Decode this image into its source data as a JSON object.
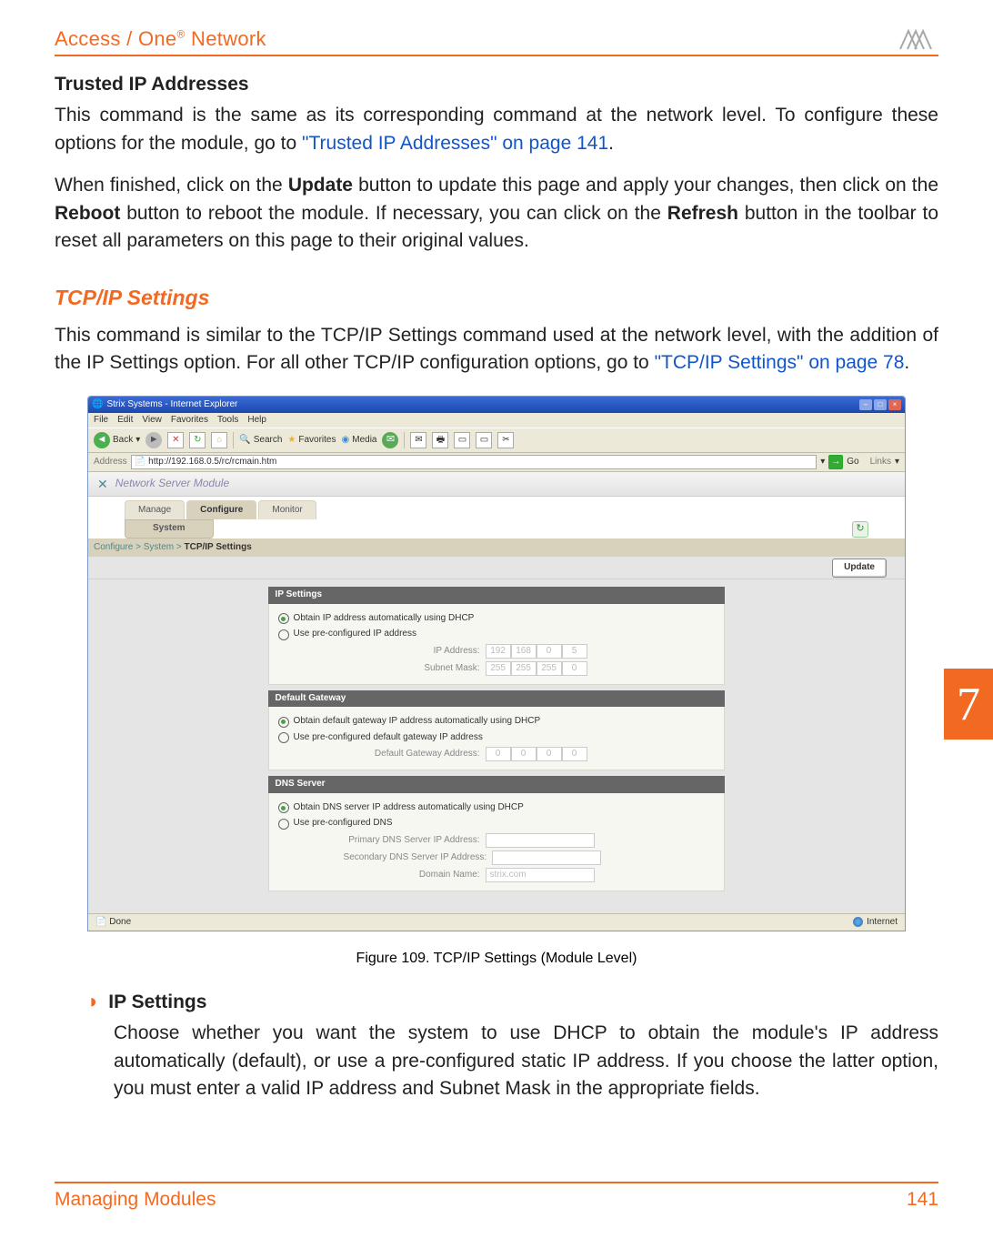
{
  "header": {
    "product_line": "Access / One",
    "reg": "®",
    "product_suffix": " Network"
  },
  "section1": {
    "title": "Trusted IP Addresses",
    "para1a": "This command is the same as its corresponding command at the network level. To configure these options for the module, go to ",
    "link1": "\"Trusted IP Addresses\" on page 141",
    "para1b": ".",
    "para2a": "When finished, click on the ",
    "b1": "Update",
    "para2b": " button to update this page and apply your changes, then click on the ",
    "b2": "Reboot",
    "para2c": " button to reboot the module. If necessary, you can click on the ",
    "b3": "Refresh",
    "para2d": " button in the toolbar to reset all parameters on this page to their original values."
  },
  "section2": {
    "title": "TCP/IP Settings",
    "para1a": "This command is similar to the TCP/IP Settings command used at the network level, with the addition of the IP Settings option. For all other TCP/IP configuration options, go to ",
    "link1": "\"TCP/IP Settings\" on page 78",
    "para1b": "."
  },
  "figure": {
    "caption": "Figure 109. TCP/IP Settings (Module Level)",
    "ie": {
      "title": "Strix Systems - Internet Explorer",
      "menu": {
        "file": "File",
        "edit": "Edit",
        "view": "View",
        "favorites": "Favorites",
        "tools": "Tools",
        "help": "Help"
      },
      "toolbar": {
        "back": "Back",
        "search": "Search",
        "favorites": "Favorites",
        "media": "Media"
      },
      "address_label": "Address",
      "address_value": "http://192.168.0.5/rc/rcmain.htm",
      "go": "Go",
      "links": "Links",
      "module_bar": "Network Server Module",
      "tabs": {
        "manage": "Manage",
        "configure": "Configure",
        "monitor": "Monitor"
      },
      "subtab": "System",
      "breadcrumb_prefix": "Configure > System > ",
      "breadcrumb_current": "TCP/IP Settings",
      "update_btn": "Update",
      "panels": {
        "ip": {
          "title": "IP Settings",
          "opt1": "Obtain IP address automatically using DHCP",
          "opt2": "Use pre-configured IP address",
          "ip_label": "IP Address:",
          "ip_octets": [
            "192",
            "168",
            "0",
            "5"
          ],
          "mask_label": "Subnet Mask:",
          "mask_octets": [
            "255",
            "255",
            "255",
            "0"
          ]
        },
        "gw": {
          "title": "Default Gateway",
          "opt1": "Obtain default gateway IP address automatically using DHCP",
          "opt2": "Use pre-configured default gateway IP address",
          "gw_label": "Default Gateway Address:",
          "gw_octets": [
            "0",
            "0",
            "0",
            "0"
          ]
        },
        "dns": {
          "title": "DNS Server",
          "opt1": "Obtain DNS server IP address automatically using DHCP",
          "opt2": "Use pre-configured DNS",
          "primary_label": "Primary DNS Server IP Address:",
          "secondary_label": "Secondary DNS Server IP Address:",
          "domain_label": "Domain Name:",
          "domain_value": "strix.com"
        }
      },
      "status_left": "Done",
      "status_right": "Internet"
    }
  },
  "bullet": {
    "title": "IP Settings",
    "body": "Choose whether you want the system to use DHCP to obtain the module's IP address automatically (default), or use a pre-configured static IP address. If you choose the latter option, you must enter a valid IP address and Subnet Mask in the appropriate fields."
  },
  "chapter": "7",
  "footer": {
    "left": "Managing Modules",
    "right": "141"
  }
}
